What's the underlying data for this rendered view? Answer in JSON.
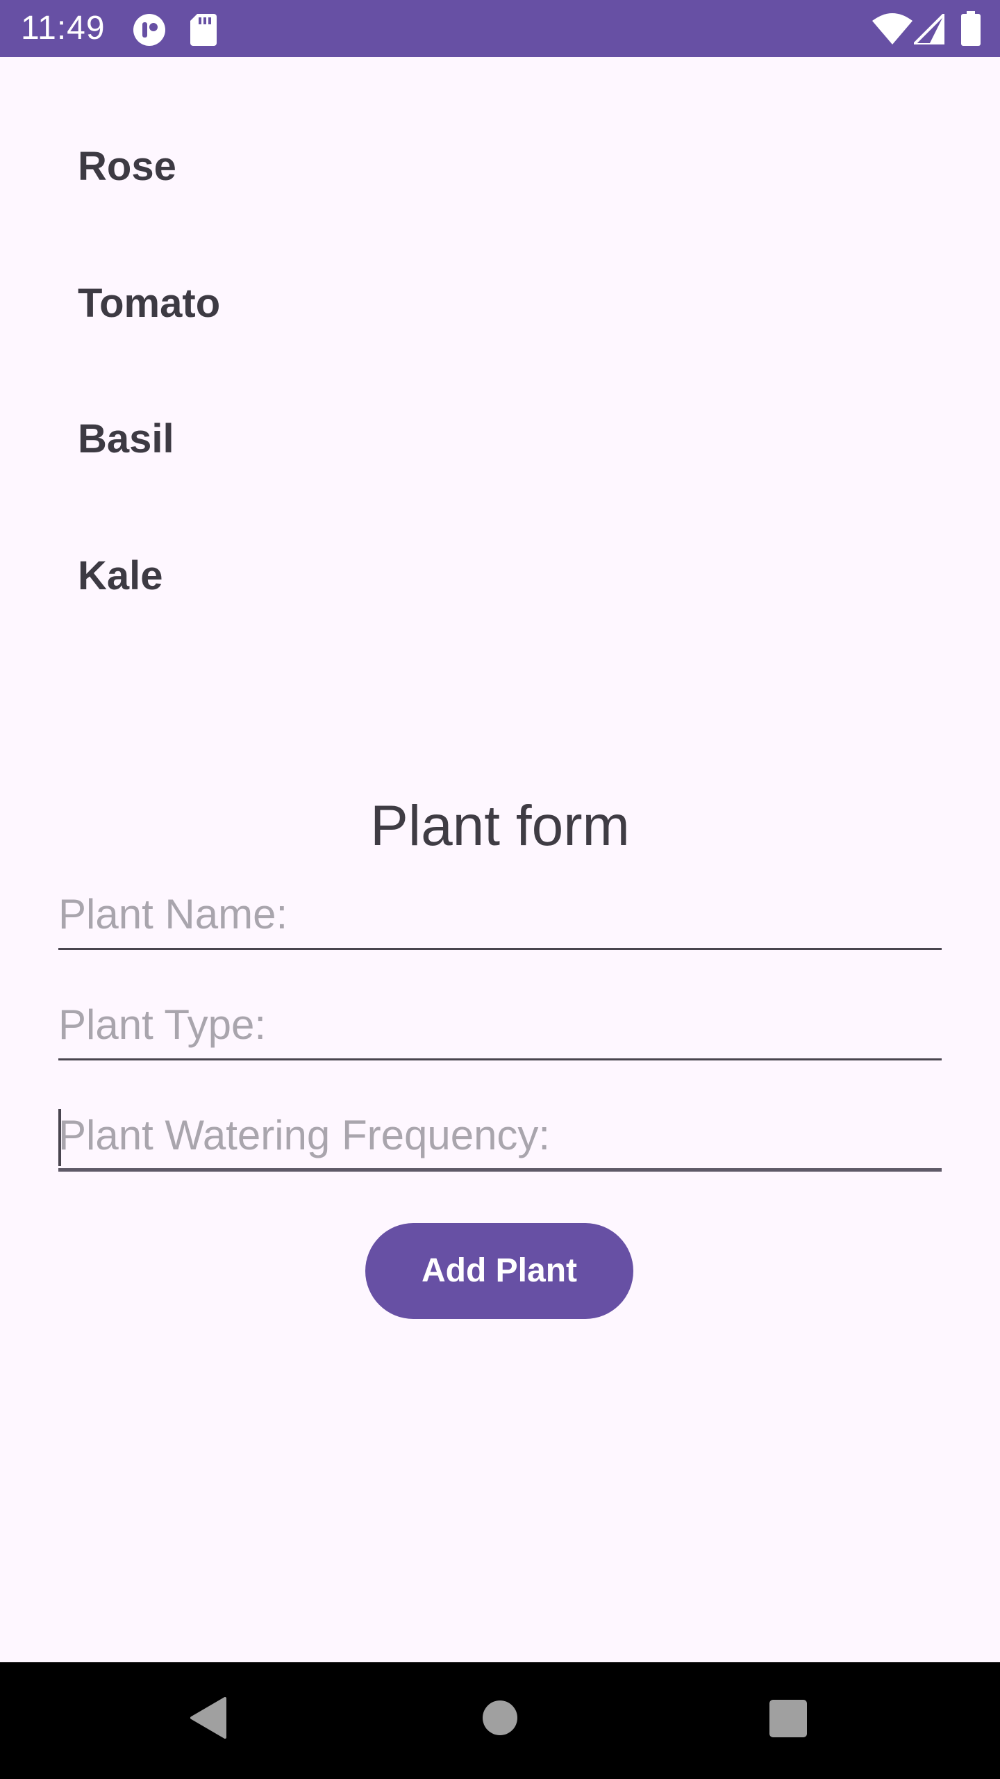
{
  "status_bar": {
    "time": "11:49",
    "icons": [
      "headset-app-icon",
      "sd-card-icon",
      "wifi-icon",
      "cellular-signal-icon",
      "battery-icon"
    ],
    "color": "#6750A4"
  },
  "plant_list": {
    "items": [
      {
        "name": "Rose"
      },
      {
        "name": "Tomato"
      },
      {
        "name": "Basil"
      },
      {
        "name": "Kale"
      }
    ]
  },
  "form": {
    "title": "Plant form",
    "name_placeholder": "Plant Name:",
    "type_placeholder": "Plant Type:",
    "watering_placeholder": "Plant Watering Frequency:",
    "submit_label": "Add Plant"
  },
  "nav_bar": {
    "icons": [
      "back-triangle-icon",
      "home-circle-icon",
      "recents-square-icon"
    ]
  },
  "colors": {
    "accent": "#6750A4",
    "background": "#FEF7FF",
    "text": "#3D3A43",
    "placeholder": "#A9A5AD"
  }
}
